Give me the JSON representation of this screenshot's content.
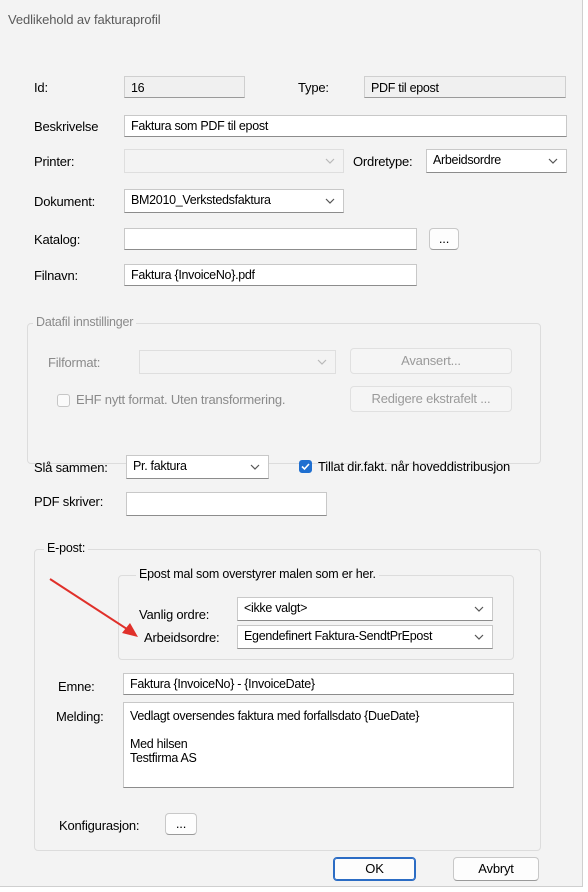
{
  "window": {
    "title": "Vedlikehold av fakturaprofil"
  },
  "id": {
    "label": "Id:",
    "value": "16"
  },
  "type": {
    "label": "Type:",
    "value": "PDF til epost"
  },
  "beskrivelse": {
    "label": "Beskrivelse",
    "value": "Faktura som PDF til epost"
  },
  "printer": {
    "label": "Printer:",
    "value": ""
  },
  "ordretype": {
    "label": "Ordretype:",
    "value": "Arbeidsordre"
  },
  "dokument": {
    "label": "Dokument:",
    "value": "BM2010_Verkstedsfaktura"
  },
  "katalog": {
    "label": "Katalog:",
    "value": "",
    "browse_label": "..."
  },
  "filnavn": {
    "label": "Filnavn:",
    "value": "Faktura {InvoiceNo}.pdf"
  },
  "datafil": {
    "group_label": "Datafil innstillinger",
    "filformat_label": "Filformat:",
    "filformat_value": "",
    "avansert_label": "Avansert...",
    "ehf_label": "EHF nytt format. Uten transformering.",
    "ehf_checked": false,
    "redigere_label": "Redigere ekstrafelt ..."
  },
  "sla_sammen": {
    "label": "Slå sammen:",
    "value": "Pr. faktura"
  },
  "tillat": {
    "label": "Tillat dir.fakt. når hoveddistribusjon",
    "checked": true
  },
  "pdf_skriver": {
    "label": "PDF skriver:",
    "value": ""
  },
  "epost": {
    "group_label": "E-post:",
    "mal_group_label": "Epost mal som overstyrer malen som er her.",
    "vanlig_label": "Vanlig ordre:",
    "vanlig_value": "<ikke valgt>",
    "arbeid_label": "Arbeidsordre:",
    "arbeid_value": "Egendefinert Faktura-SendtPrEpost",
    "emne_label": "Emne:",
    "emne_value": "Faktura {InvoiceNo} -  {InvoiceDate}",
    "melding_label": "Melding:",
    "melding_lines": [
      "Vedlagt oversendes faktura med forfallsdato {DueDate}",
      "",
      "Med hilsen",
      "Testfirma AS"
    ],
    "konfig_label": "Konfigurasjon:",
    "konfig_btn": "..."
  },
  "buttons": {
    "ok": "OK",
    "avbryt": "Avbryt"
  },
  "colors": {
    "accent": "#1f6fd0",
    "arrow": "#e0302a"
  }
}
